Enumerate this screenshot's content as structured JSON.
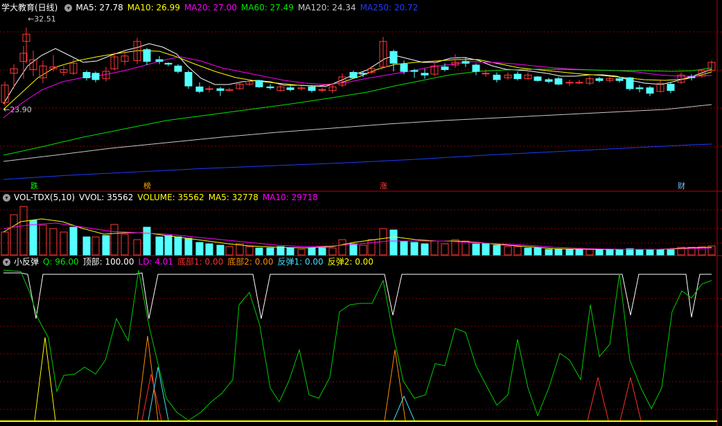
{
  "main": {
    "title": "学大教育(日线)",
    "indicators": [
      {
        "label": "MA5: 27.78",
        "color": "#ffffff"
      },
      {
        "label": "MA10: 26.99",
        "color": "#ffff00"
      },
      {
        "label": "MA20: 27.00",
        "color": "#ff00ff"
      },
      {
        "label": "MA60: 27.49",
        "color": "#00e600"
      },
      {
        "label": "MA120: 24.34",
        "color": "#c8c8c8"
      },
      {
        "label": "MA250: 20.72",
        "color": "#1e3cff"
      }
    ],
    "high_label": "32.51",
    "low_label": "23.90",
    "flags": [
      {
        "text": "跌",
        "color": "#00ff00"
      },
      {
        "text": "榜",
        "color": "#ffaa00"
      },
      {
        "text": "涨",
        "color": "#ff4040"
      },
      {
        "text": "财",
        "color": "#80c0ff"
      }
    ]
  },
  "volume": {
    "title": "VOL-TDX(5,10)",
    "indicators": [
      {
        "label": "VVOL: 35562",
        "color": "#ffffff"
      },
      {
        "label": "VOLUME: 35562",
        "color": "#ffff00"
      },
      {
        "label": "MA5: 32778",
        "color": "#ffff00"
      },
      {
        "label": "MA10: 29718",
        "color": "#ff00ff"
      }
    ]
  },
  "rebound": {
    "title": "小反弹",
    "indicators": [
      {
        "label": "Q: 96.00",
        "color": "#00e600"
      },
      {
        "label": "顶部: 100.00",
        "color": "#ffffff"
      },
      {
        "label": "LD: 4.01",
        "color": "#ff00ff"
      },
      {
        "label": "底部1: 0.00",
        "color": "#ff3030"
      },
      {
        "label": "底部2: 0.00",
        "color": "#ff8c00"
      },
      {
        "label": "反弹1: 0.00",
        "color": "#40e0ff"
      },
      {
        "label": "反弹2: 0.00",
        "color": "#ffff00"
      }
    ]
  },
  "colors": {
    "up": "#ff3a3a",
    "down": "#54ffff",
    "grid": "#8b0000"
  }
}
